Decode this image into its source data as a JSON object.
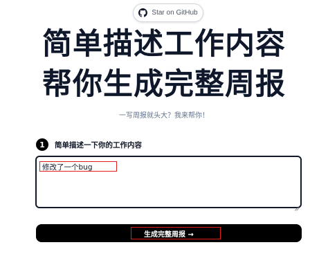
{
  "github_button": {
    "label": "Star on GitHub",
    "icon": "github-icon"
  },
  "hero": {
    "title_line1": "简单描述工作内容",
    "title_line2": "帮你生成完整周报",
    "subtitle": "一写周报就头大？我来帮你！"
  },
  "step1": {
    "number": "1",
    "label": "简单描述一下你的工作内容"
  },
  "work_input": {
    "value": "修改了一个bug"
  },
  "generate_button": {
    "label": "生成完整周报 →"
  },
  "colors": {
    "annotation_box": "#e11d1d",
    "button_bg": "#000000",
    "title_text": "#0f172a",
    "subtitle_text": "#64748b"
  }
}
